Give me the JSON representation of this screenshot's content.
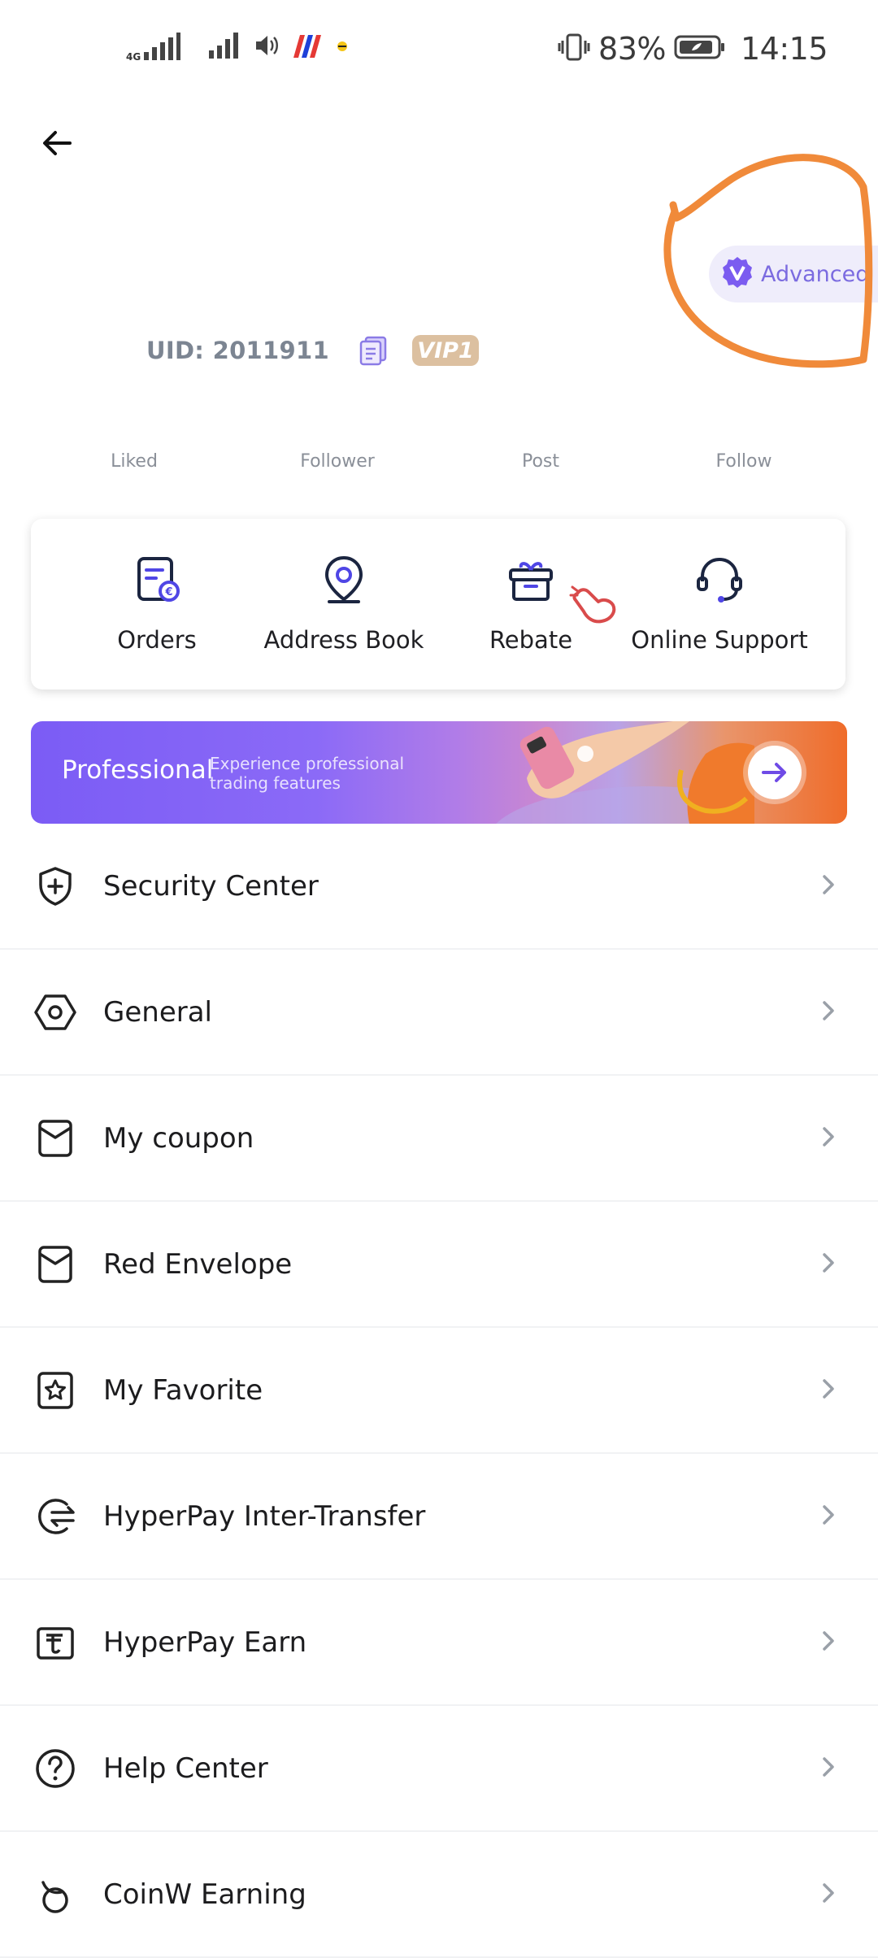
{
  "status_bar": {
    "network": "4G",
    "battery": "83%",
    "time": "14:15"
  },
  "profile": {
    "advanced_label": "Advanced",
    "uid": "UID: 2011911",
    "vip": "VIP1",
    "stats": [
      "Liked",
      "Follower",
      "Post",
      "Follow"
    ]
  },
  "quick_actions": [
    {
      "label": "Orders",
      "icon": "orders-icon"
    },
    {
      "label": "Address Book",
      "icon": "location-pin-icon"
    },
    {
      "label": "Rebate",
      "icon": "gift-box-icon"
    },
    {
      "label": "Online Support",
      "icon": "headset-icon"
    }
  ],
  "banner": {
    "title": "Professional",
    "subtitle": "Experience professional trading features"
  },
  "menu": [
    {
      "label": "Security Center",
      "icon": "shield-plus-icon"
    },
    {
      "label": "General",
      "icon": "hexagon-settings-icon"
    },
    {
      "label": "My coupon",
      "icon": "coupon-icon"
    },
    {
      "label": "Red Envelope",
      "icon": "envelope-icon"
    },
    {
      "label": "My Favorite",
      "icon": "star-icon"
    },
    {
      "label": "HyperPay Inter-Transfer",
      "icon": "transfer-icon"
    },
    {
      "label": "HyperPay Earn",
      "icon": "earn-icon"
    },
    {
      "label": "Help Center",
      "icon": "help-icon"
    },
    {
      "label": "CoinW Earning",
      "icon": "earning-icon"
    }
  ],
  "colors": {
    "accent": "#7b6be0",
    "annotation": "#f08a3a",
    "vip": "#dcc0a0"
  }
}
